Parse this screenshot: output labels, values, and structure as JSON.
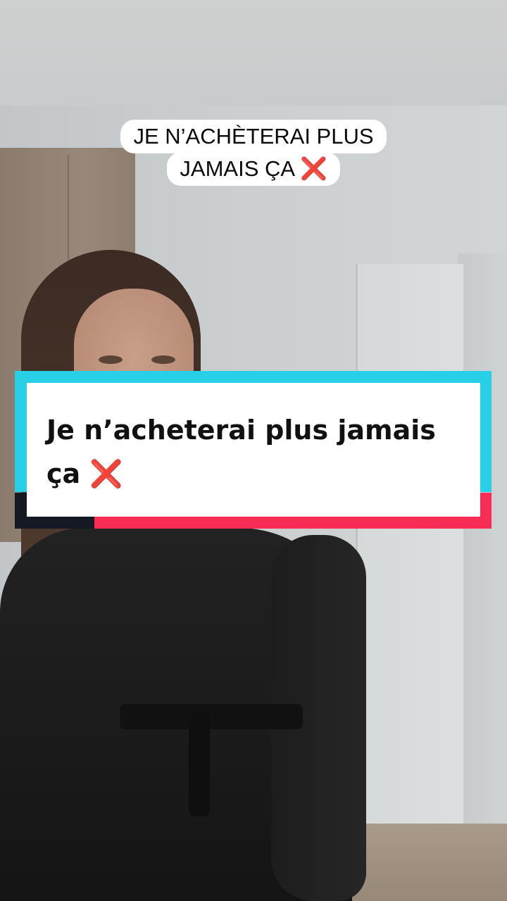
{
  "video": {
    "top_caption_line1": "JE N’ACHÈTERAI PLUS",
    "top_caption_line2": "JAMAIS ÇA",
    "title_card_line1": "Je n’acheterai plus jamais",
    "title_card_line2": "ça",
    "cross_emoji": "❌"
  },
  "colors": {
    "accent_cyan": "#27d0e6",
    "accent_red": "#f72d55",
    "accent_dark": "#151923"
  }
}
